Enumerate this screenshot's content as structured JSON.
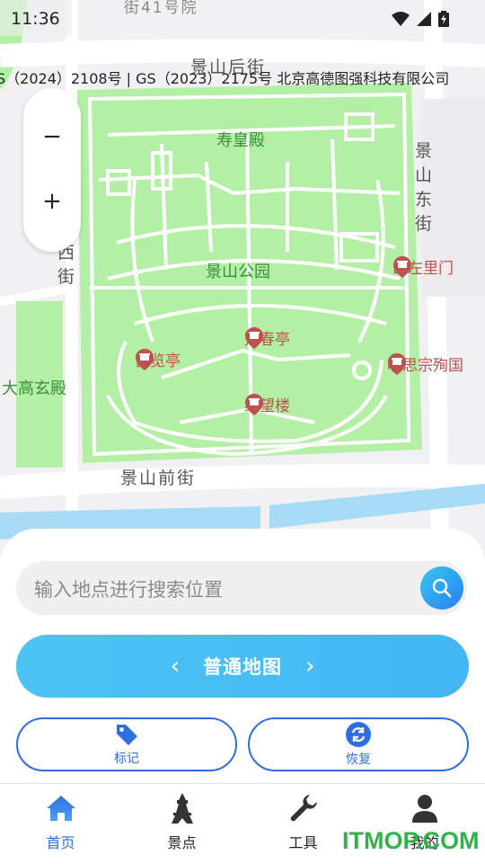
{
  "status_bar": {
    "time": "11:36"
  },
  "map": {
    "approval_text": "S（2024）2108号 | GS（2023）2175号 北京高德图强科技有限公司",
    "labels": {
      "jie41": "街41号院",
      "jingshan_hou_jie": "景山后街",
      "jingshan_dong_jie": "景山东街",
      "xi_jie": "西街",
      "jingshan_qian_jie": "景山前街",
      "shouhuang_dian": "寿皇殿",
      "jingshan_park": "景山公园",
      "dagaoxuan_dian": "大高玄殿"
    },
    "pois": {
      "wanchun": "万春亭",
      "fulan": "富览亭",
      "qiwang": "绮望楼",
      "shanzuo": "山左里门",
      "mingsi": "明思宗殉国"
    }
  },
  "zoom": {
    "minus": "−",
    "plus": "+"
  },
  "search": {
    "placeholder": "输入地点进行搜索位置"
  },
  "map_type": {
    "label": "普通地图",
    "prev": "‹",
    "next": "›"
  },
  "actions": {
    "mark": "标记",
    "restore": "恢复"
  },
  "tabs": [
    {
      "label": "首页"
    },
    {
      "label": "景点"
    },
    {
      "label": "工具"
    },
    {
      "label": "我的"
    }
  ],
  "watermark": "ITMOP.COM",
  "colors": {
    "accent": "#2e6fe0",
    "park_green": "#b3f0a6",
    "river": "#a8dcf6",
    "poi_red": "#c0504d"
  }
}
